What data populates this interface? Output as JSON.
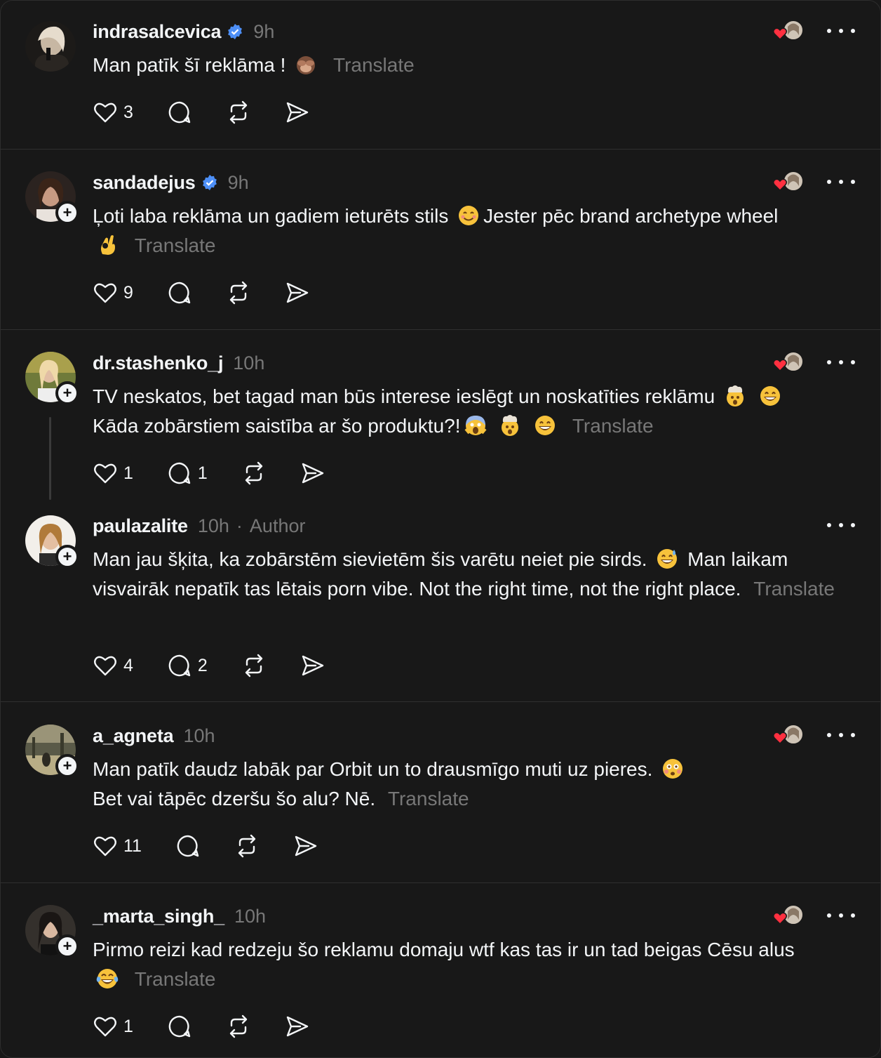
{
  "ui": {
    "translate_label": "Translate",
    "author_label": "Author",
    "author_separator": "·"
  },
  "colors": {
    "background": "#181818",
    "text": "#f3f5f7",
    "muted": "#777777",
    "verified": "#4d8ff7",
    "heart": "#ff3040"
  },
  "posts": [
    {
      "username": "indrasalcevica",
      "verified": true,
      "time": "9h",
      "text": "Man patīk šī reklāma !",
      "emoji": "see-no-evil-monkey",
      "translate": "Translate",
      "likes": "3",
      "replies": ""
    },
    {
      "username": "sandadejus",
      "verified": true,
      "time": "9h",
      "text": "Ļoti laba reklāma un gadiem ieturēts stils",
      "text_after_emoji": "Jester pēc brand archetype wheel",
      "emoji": "smiling-face",
      "emoji_2": "ok-hand",
      "translate": "Translate",
      "likes": "9",
      "replies": ""
    },
    {
      "username": "dr.stashenko_j",
      "verified": false,
      "time": "10h",
      "line1": "TV neskatos, bet tagad man būs interese ieslēgt un noskatīties reklāmu",
      "line2": "Kāda zobārstiem saistība ar šo produktu?!",
      "translate": "Translate",
      "likes": "1",
      "replies": "1"
    },
    {
      "username": "paulazalite",
      "verified": false,
      "time": "10h",
      "is_author": true,
      "text_part1": "Man jau šķita, ka zobārstēm sievietēm šis varētu neiet pie sirds.",
      "text_part2": "Man laikam visvairāk nepatīk tas lētais porn vibe. Not the right time, not the right place.",
      "translate": "Translate",
      "likes": "4",
      "replies": "2"
    },
    {
      "username": "a_agneta",
      "verified": false,
      "time": "10h",
      "line1": "Man patīk daudz labāk par Orbit un to drausmīgo muti uz pieres.",
      "line2": "Bet vai tāpēc dzeršu šo alu? Nē.",
      "translate": "Translate",
      "likes": "11",
      "replies": ""
    },
    {
      "username": "_marta_singh_",
      "verified": false,
      "time": "10h",
      "text": "Pirmo reizi kad redzeju šo reklamu domaju wtf kas tas ir un tad beigas Cēsu alus",
      "translate": "Translate",
      "likes": "1",
      "replies": ""
    }
  ]
}
